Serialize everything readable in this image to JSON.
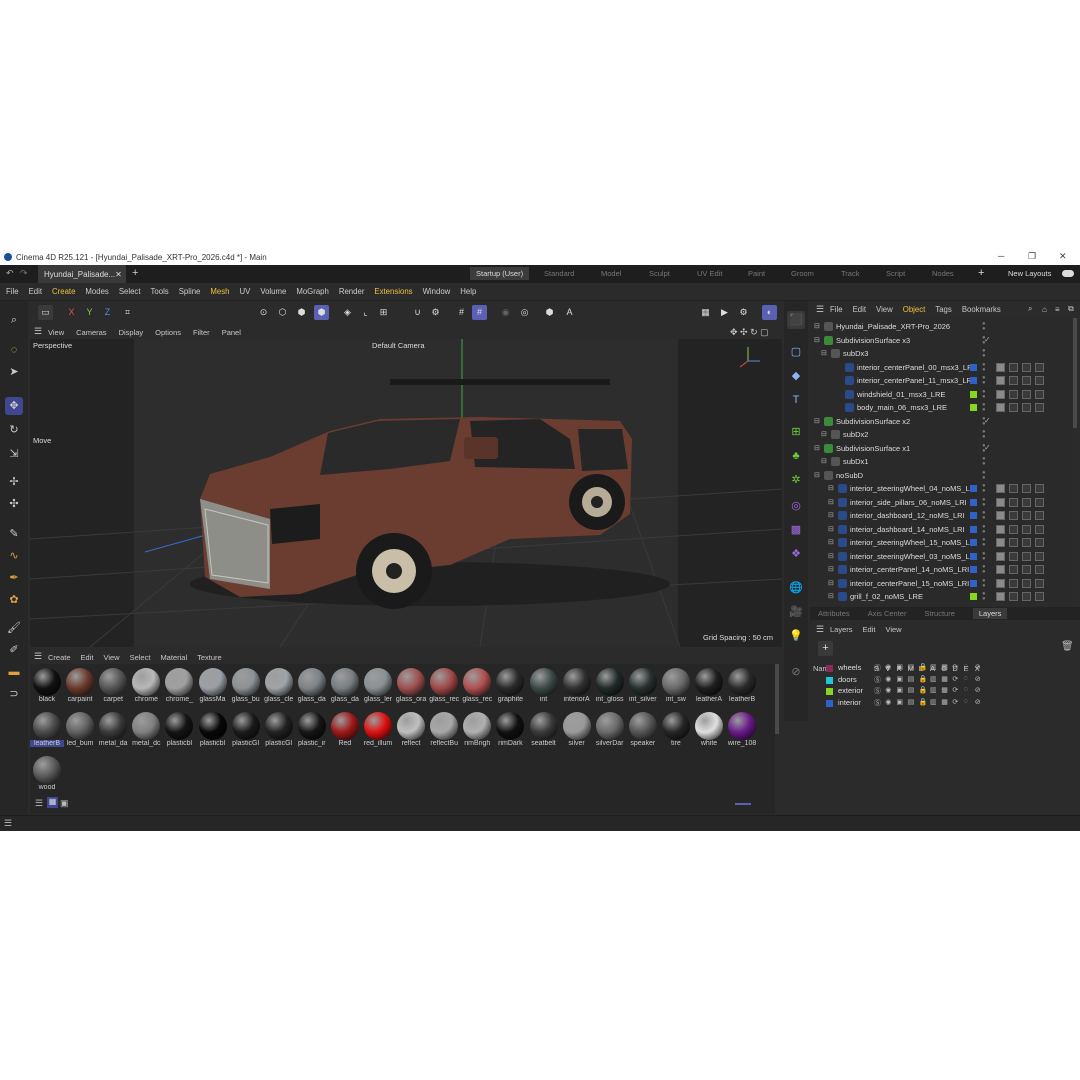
{
  "titlebar": {
    "title": "Cinema 4D R25.121 - [Hyundai_Palisade_XRT-Pro_2026.c4d *] - Main"
  },
  "tabs": {
    "doc": "Hyundai_Palisade...",
    "layouts": [
      "Startup (User)",
      "Standard",
      "Model",
      "Sculpt",
      "UV Edit",
      "Paint",
      "Groom",
      "Track",
      "Script",
      "Nodes"
    ],
    "new_layouts": "New Layouts"
  },
  "menu": [
    "File",
    "Edit",
    "Create",
    "Modes",
    "Select",
    "Tools",
    "Spline",
    "Mesh",
    "UV",
    "Volume",
    "MoGraph",
    "Render",
    "Extensions",
    "Window",
    "Help"
  ],
  "toolbar": {
    "axes": [
      "X",
      "Y",
      "Z"
    ]
  },
  "viewport": {
    "menu": [
      "View",
      "Cameras",
      "Display",
      "Options",
      "Filter",
      "Panel"
    ],
    "label": "Perspective",
    "camera": "Default Camera",
    "move_label": "Move",
    "grid_spacing": "Grid Spacing : 50 cm"
  },
  "materials": {
    "menu": [
      "Create",
      "Edit",
      "View",
      "Select",
      "Material",
      "Texture"
    ],
    "items": [
      {
        "name": "black",
        "color": "#111111"
      },
      {
        "name": "carpaint",
        "color": "#6b3a2c"
      },
      {
        "name": "carpet",
        "color": "#555555"
      },
      {
        "name": "chrome",
        "color": "#b8b8b8"
      },
      {
        "name": "chrome_",
        "color": "#a0a0a0"
      },
      {
        "name": "glassMa",
        "color": "#9aa0a6"
      },
      {
        "name": "glass_bu",
        "color": "#8c9296"
      },
      {
        "name": "glass_cle",
        "color": "#9ea4a8"
      },
      {
        "name": "glass_da",
        "color": "#7c8286"
      },
      {
        "name": "glass_da",
        "color": "#787e82"
      },
      {
        "name": "glass_ler",
        "color": "#8a9094"
      },
      {
        "name": "glass_ora",
        "color": "#a05050"
      },
      {
        "name": "glass_rec",
        "color": "#a04848"
      },
      {
        "name": "glass_rec",
        "color": "#b05050"
      },
      {
        "name": "graphite",
        "color": "#2a2a2a"
      },
      {
        "name": "int",
        "color": "#3c4a48"
      },
      {
        "name": "interiorA",
        "color": "#303030"
      },
      {
        "name": "int_gloss",
        "color": "#202a28"
      },
      {
        "name": "int_silver",
        "color": "#283030"
      },
      {
        "name": "int_sw",
        "color": "#6a6a6a"
      },
      {
        "name": "leatherA",
        "color": "#1e1e1e"
      },
      {
        "name": "leatherB",
        "color": "#2a2a2a"
      },
      {
        "name": "leatherB",
        "color": "#4a4a4a"
      },
      {
        "name": "led_bum",
        "color": "#606060"
      },
      {
        "name": "metal_da",
        "color": "#3a3a3a"
      },
      {
        "name": "metal_dc",
        "color": "#808080"
      },
      {
        "name": "plasticbl",
        "color": "#141414"
      },
      {
        "name": "plasticbl",
        "color": "#080808"
      },
      {
        "name": "plasticGl",
        "color": "#1a1a1a"
      },
      {
        "name": "plasticGl",
        "color": "#222222"
      },
      {
        "name": "plastic_ir",
        "color": "#151515"
      },
      {
        "name": "Red",
        "color": "#a01818"
      },
      {
        "name": "red_illum",
        "color": "#e01010"
      },
      {
        "name": "reflect",
        "color": "#c0c0c0"
      },
      {
        "name": "reflectBu",
        "color": "#a8a8a8"
      },
      {
        "name": "rimBrigh",
        "color": "#b0b0b0"
      },
      {
        "name": "rimDark",
        "color": "#111111"
      },
      {
        "name": "seatbelt",
        "color": "#3a3a3a"
      },
      {
        "name": "silver",
        "color": "#9a9a9a"
      },
      {
        "name": "silverDar",
        "color": "#6a6a6a"
      },
      {
        "name": "speaker",
        "color": "#555555"
      },
      {
        "name": "tire",
        "color": "#252525"
      },
      {
        "name": "white",
        "color": "#e0e0e0"
      },
      {
        "name": "wire_108",
        "color": "#6a1a8a"
      },
      {
        "name": "wood",
        "color": "#5a5a5a"
      }
    ],
    "selected_index": 22
  },
  "objects": {
    "menu": [
      "File",
      "Edit",
      "View",
      "Object",
      "Tags",
      "Bookmarks"
    ],
    "rows": [
      {
        "name": "Hyundai_Palisade_XRT-Pro_2026",
        "indent": 0,
        "icon": "null",
        "tag": ""
      },
      {
        "name": "SubdivisionSurface x3",
        "indent": 0,
        "icon": "subdiv",
        "tag": "check"
      },
      {
        "name": "subDx3",
        "indent": 1,
        "icon": "null",
        "tag": ""
      },
      {
        "name": "interior_centerPanel_00_msx3_LRI",
        "indent": 3,
        "icon": "poly",
        "tag": "#2f62c9"
      },
      {
        "name": "interior_centerPanel_11_msx3_LRI",
        "indent": 3,
        "icon": "poly",
        "tag": "#2f62c9"
      },
      {
        "name": "windshield_01_msx3_LRE",
        "indent": 3,
        "icon": "poly",
        "tag": "#86d61e"
      },
      {
        "name": "body_main_06_msx3_LRE",
        "indent": 3,
        "icon": "poly",
        "tag": "#86d61e"
      },
      {
        "name": "SubdivisionSurface x2",
        "indent": 0,
        "icon": "subdiv",
        "tag": "check"
      },
      {
        "name": "subDx2",
        "indent": 1,
        "icon": "null",
        "tag": ""
      },
      {
        "name": "SubdivisionSurface x1",
        "indent": 0,
        "icon": "subdiv",
        "tag": "check"
      },
      {
        "name": "subDx1",
        "indent": 1,
        "icon": "null",
        "tag": ""
      },
      {
        "name": "noSubD",
        "indent": 0,
        "icon": "null",
        "tag": ""
      },
      {
        "name": "interior_steeringWheel_04_noMS_LRI",
        "indent": 2,
        "icon": "poly",
        "tag": "#2f62c9"
      },
      {
        "name": "interior_side_pillars_06_noMS_LRI",
        "indent": 2,
        "icon": "poly",
        "tag": "#2f62c9"
      },
      {
        "name": "interior_dashboard_12_noMS_LRI",
        "indent": 2,
        "icon": "poly",
        "tag": "#2f62c9"
      },
      {
        "name": "interior_dashboard_14_noMS_LRI",
        "indent": 2,
        "icon": "poly",
        "tag": "#2f62c9"
      },
      {
        "name": "interior_steeringWheel_15_noMS_LRI",
        "indent": 2,
        "icon": "poly",
        "tag": "#2f62c9"
      },
      {
        "name": "interior_steeringWheel_03_noMS_LRI",
        "indent": 2,
        "icon": "poly",
        "tag": "#2f62c9"
      },
      {
        "name": "interior_centerPanel_14_noMS_LRI",
        "indent": 2,
        "icon": "poly",
        "tag": "#2f62c9"
      },
      {
        "name": "interior_centerPanel_15_noMS_LRI",
        "indent": 2,
        "icon": "poly",
        "tag": "#2f62c9"
      },
      {
        "name": "grill_f_02_noMS_LRE",
        "indent": 2,
        "icon": "poly",
        "tag": "#86d61e"
      }
    ]
  },
  "attributes": {
    "tabs": [
      "Attributes",
      "Axis Center",
      "Structure",
      "Layers"
    ],
    "active": "Layers"
  },
  "layers": {
    "menu": [
      "Layers",
      "Edit",
      "View"
    ],
    "columns": {
      "name": "Name",
      "flags": [
        "S",
        "V",
        "R",
        "M",
        "L",
        "A",
        "G",
        "D",
        "E",
        "X"
      ]
    },
    "items": [
      {
        "name": "wheels",
        "color": "#8a2a5a"
      },
      {
        "name": "doors",
        "color": "#1ec8d8"
      },
      {
        "name": "exterior",
        "color": "#86d61e"
      },
      {
        "name": "interior",
        "color": "#2f62c9"
      }
    ]
  },
  "colors": {
    "accent": "#5a61b4",
    "menu_highlight": "#f0c040",
    "car_body": "#6b3d31"
  }
}
